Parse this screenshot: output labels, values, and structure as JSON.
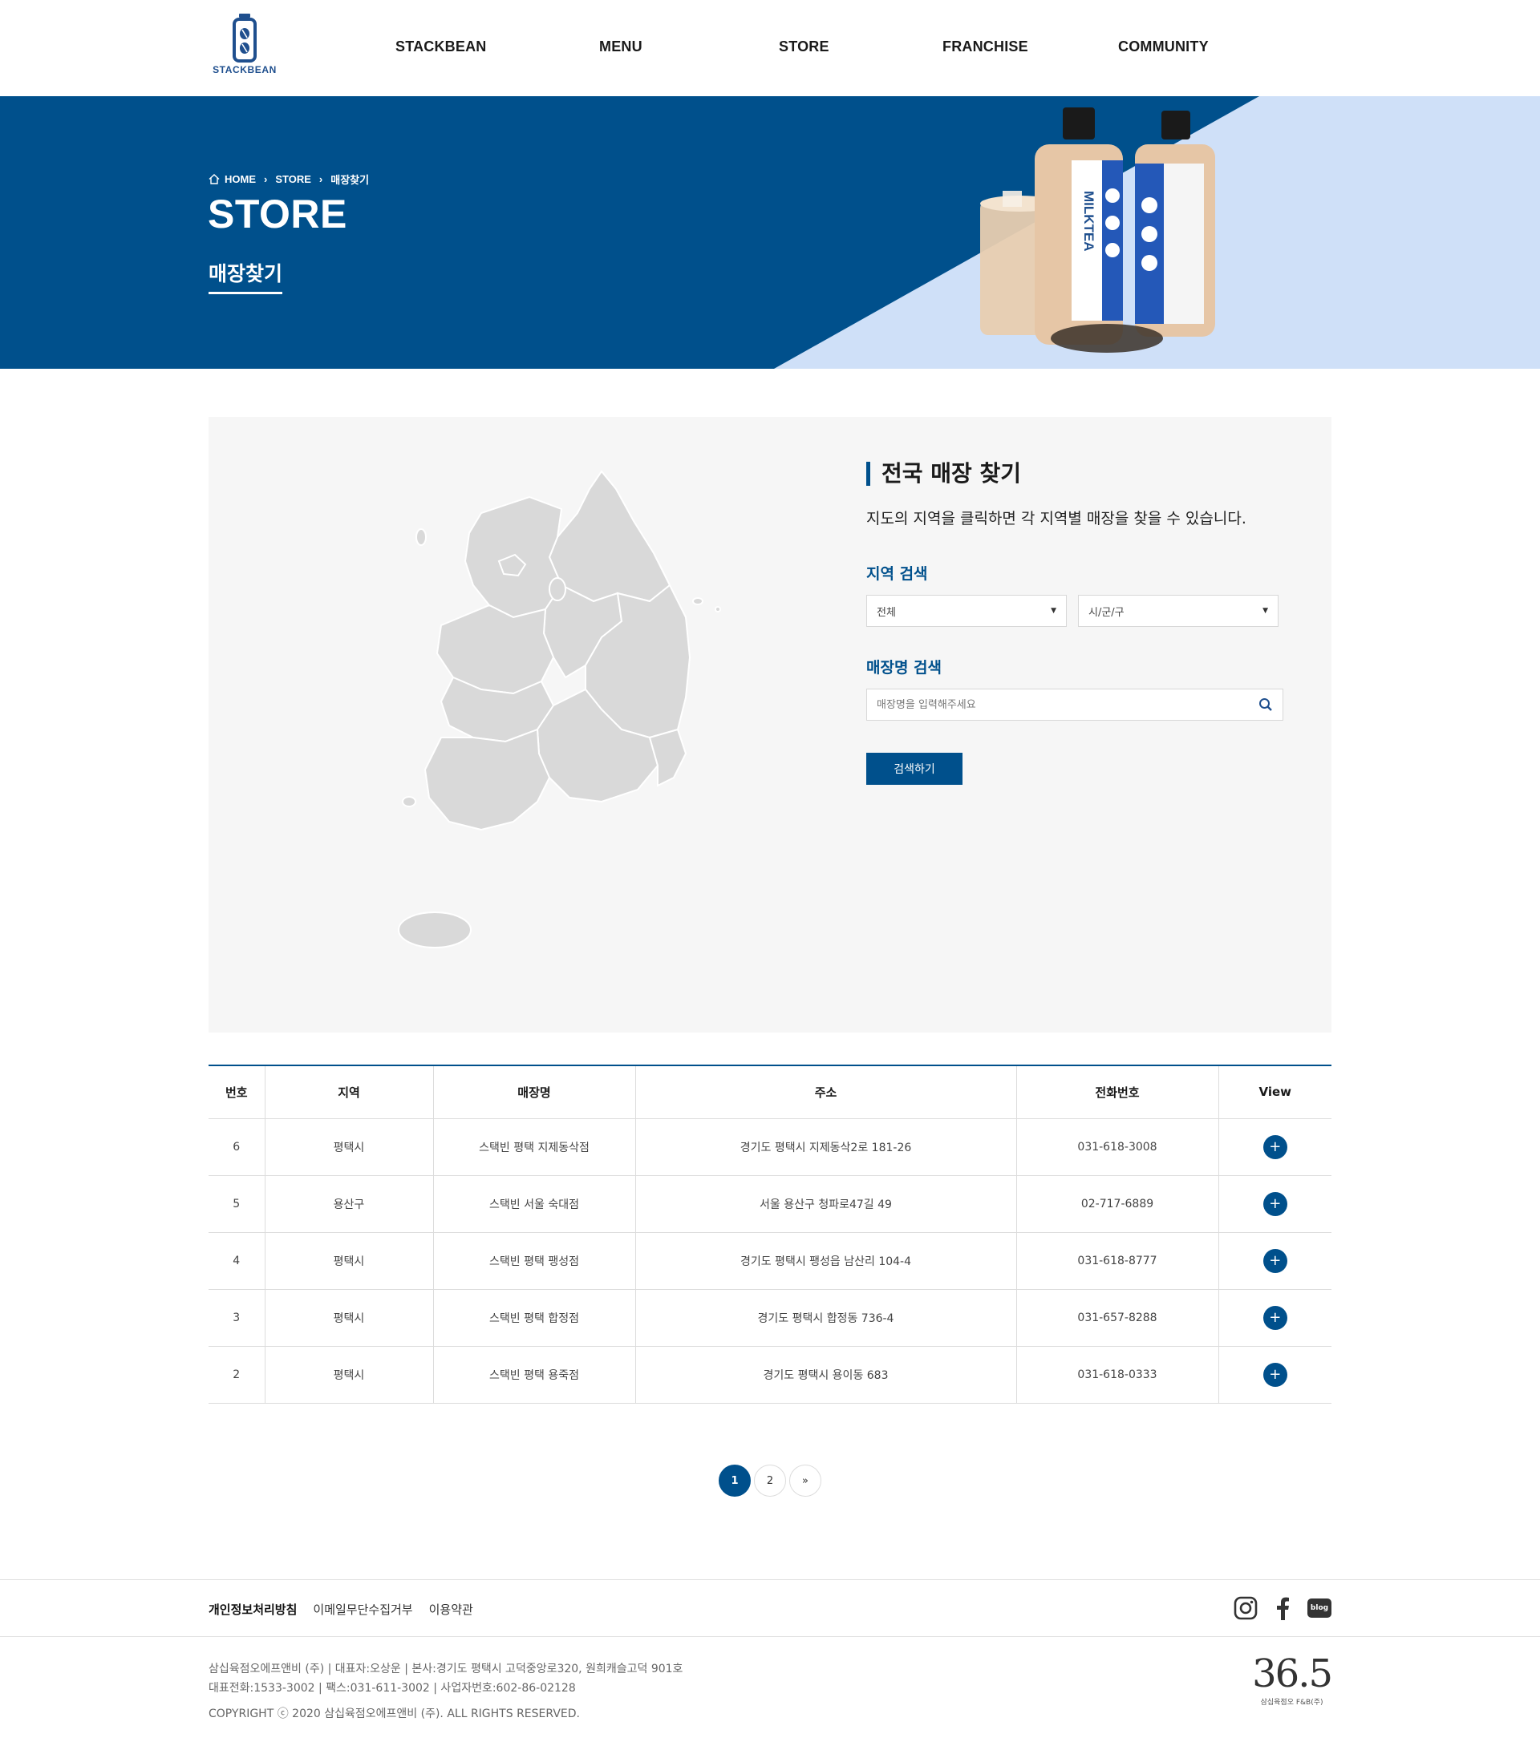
{
  "brand": {
    "logo_text": "STACKBEAN",
    "primary_color": "#00508c"
  },
  "nav": [
    "STACKBEAN",
    "MENU",
    "STORE",
    "FRANCHISE",
    "COMMUNITY"
  ],
  "hero": {
    "breadcrumb": [
      "HOME",
      "STORE",
      "매장찾기"
    ],
    "title": "STORE",
    "subtitle": "매장찾기",
    "product_label": "MILKTEA"
  },
  "search": {
    "title": "전국 매장 찾기",
    "description": "지도의 지역을 클릭하면 각 지역별 매장을 찾을 수 있습니다.",
    "region_label": "지역 검색",
    "region_select": "전체",
    "city_select": "시/군/구",
    "name_label": "매장명 검색",
    "name_placeholder": "매장명을 입력해주세요",
    "button": "검색하기"
  },
  "table": {
    "headers": [
      "번호",
      "지역",
      "매장명",
      "주소",
      "전화번호",
      "View"
    ],
    "rows": [
      {
        "no": "6",
        "region": "평택시",
        "name": "스택빈 평택 지제동삭점",
        "address": "경기도 평택시 지제동삭2로 181-26",
        "phone": "031-618-3008"
      },
      {
        "no": "5",
        "region": "용산구",
        "name": "스택빈 서울 숙대점",
        "address": "서울 용산구 청파로47길 49",
        "phone": "02-717-6889"
      },
      {
        "no": "4",
        "region": "평택시",
        "name": "스택빈 평택 팽성점",
        "address": "경기도 평택시 팽성읍 남산리 104-4",
        "phone": "031-618-8777"
      },
      {
        "no": "3",
        "region": "평택시",
        "name": "스택빈 평택 합정점",
        "address": "경기도 평택시 합정동 736-4",
        "phone": "031-657-8288"
      },
      {
        "no": "2",
        "region": "평택시",
        "name": "스택빈 평택 용죽점",
        "address": "경기도 평택시 용이동 683",
        "phone": "031-618-0333"
      }
    ],
    "view_symbol": "+"
  },
  "pagination": {
    "pages": [
      "1",
      "2"
    ],
    "next": "»"
  },
  "footer": {
    "links": [
      "개인정보처리방침",
      "이메일무단수집거부",
      "이용약관"
    ],
    "social_icons": [
      "instagram-icon",
      "facebook-icon",
      "blog-icon"
    ],
    "blog_label": "blog",
    "info_line1": "삼십육점오에프앤비 (주) | 대표자:오상운 | 본사:경기도 평택시 고덕중앙로320, 원희캐슬고덕 901호",
    "info_line2": "대표전화:1533-3002 | 팩스:031-611-3002 | 사업자번호:602-86-02128",
    "copyright": "COPYRIGHT ⓒ 2020 삼십육점오에프앤비 (주). ALL RIGHTS RESERVED.",
    "logo_number": "36.5",
    "logo_caption": "삼십육점오 F&B(주)"
  }
}
